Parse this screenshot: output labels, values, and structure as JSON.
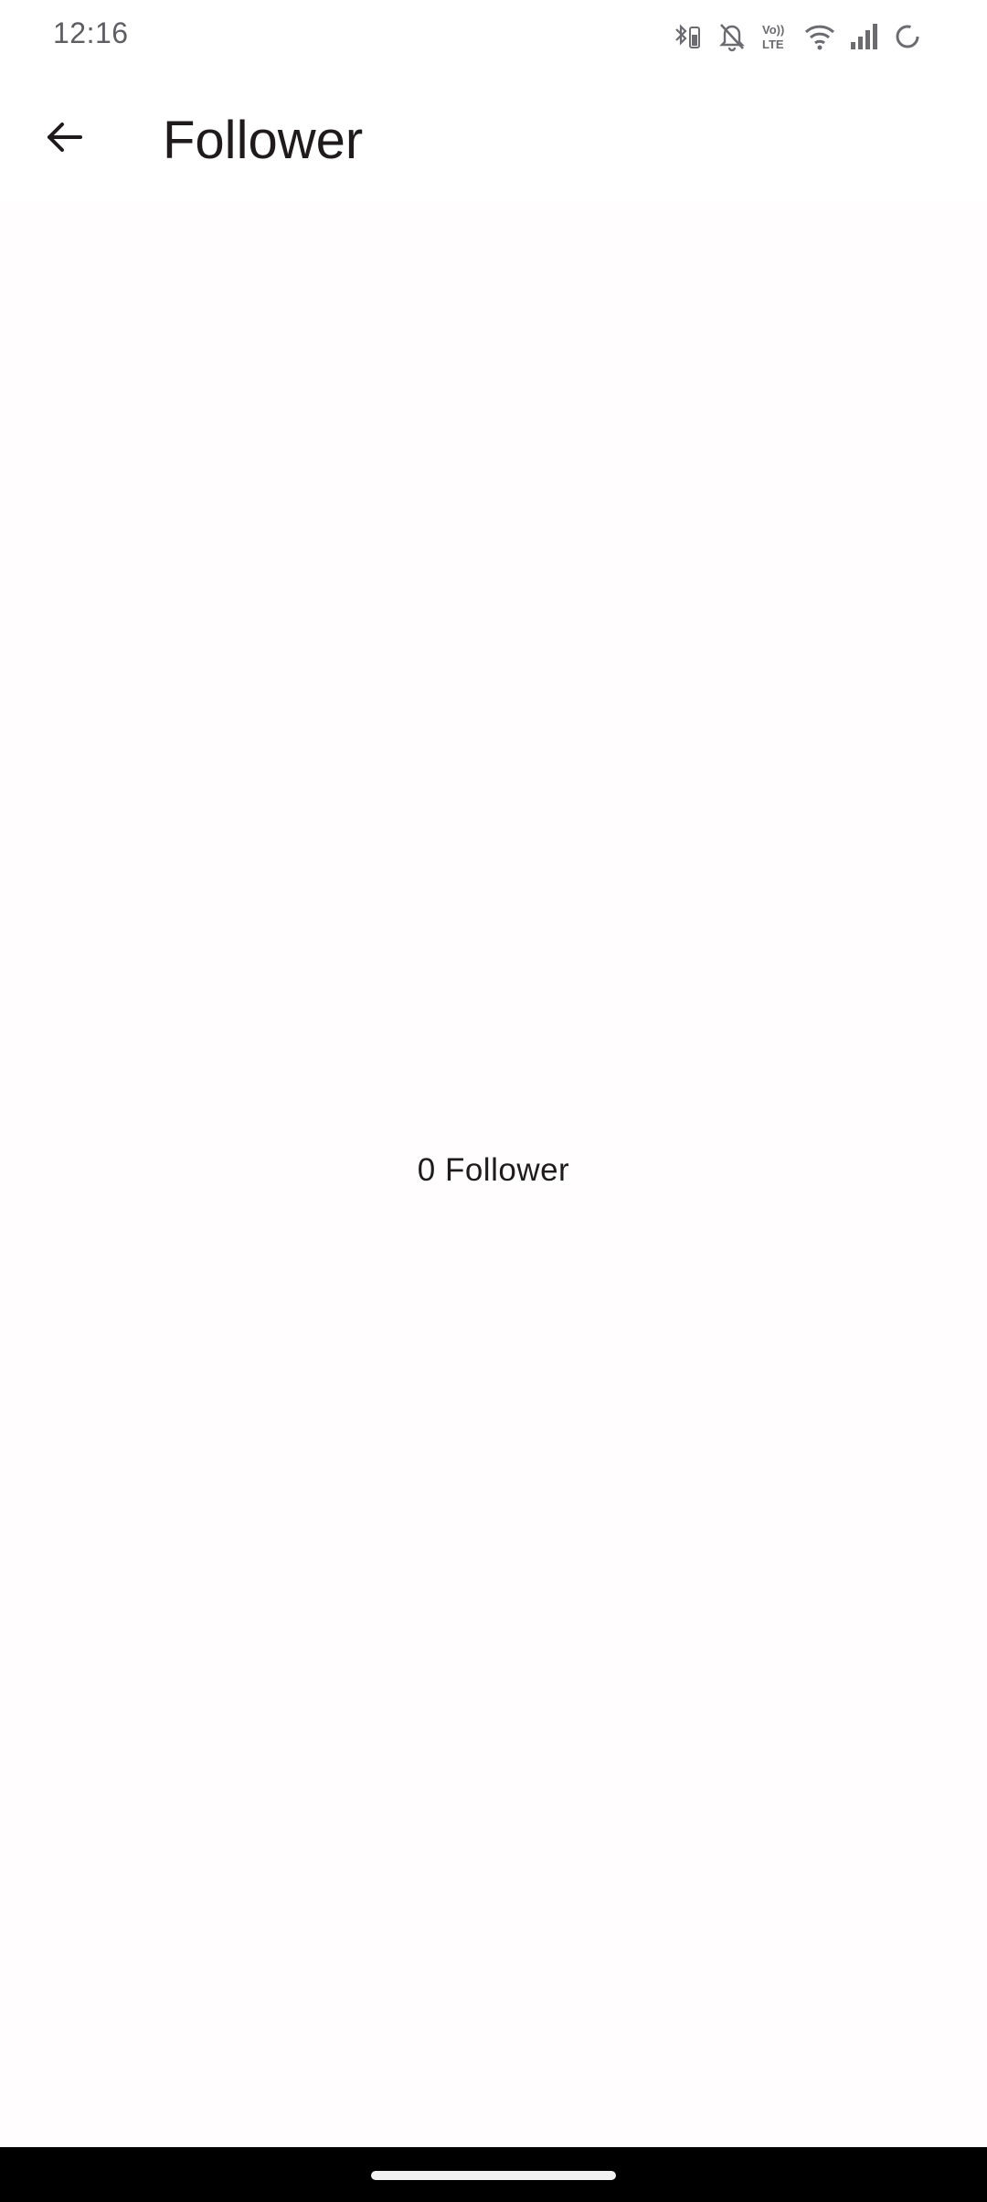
{
  "status_bar": {
    "time": "12:16",
    "icons": [
      "bluetooth-battery-icon",
      "bell-off-icon",
      "volte-icon",
      "wifi-icon",
      "signal-icon",
      "loading-icon"
    ],
    "volte_top": "Vo))",
    "volte_bottom": "LTE"
  },
  "app_bar": {
    "title": "Follower",
    "back_icon": "arrow-back-icon"
  },
  "content": {
    "empty_message": "0 Follower"
  },
  "colors": {
    "background": "#fffdfd",
    "text": "#1f1b1d",
    "status_text": "#5f5f63",
    "nav_bar": "#000000"
  }
}
